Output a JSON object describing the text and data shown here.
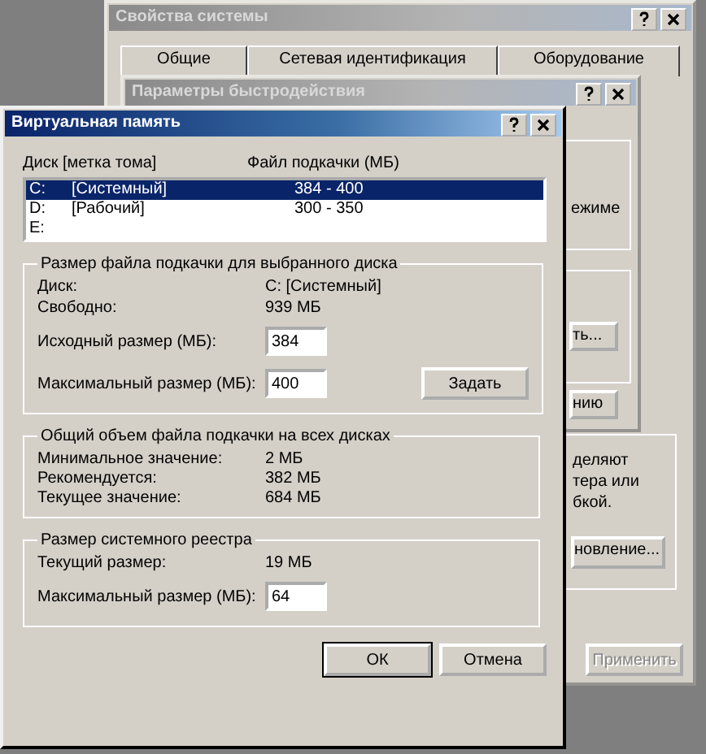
{
  "system_window": {
    "title": "Свойства системы",
    "tabs": [
      {
        "label": "Общие",
        "selected": false
      },
      {
        "label": "Сетевая идентификация",
        "selected": false
      },
      {
        "label": "Оборудование",
        "selected": false
      }
    ],
    "fragments": [
      {
        "kind": "label",
        "text": "деляют"
      },
      {
        "kind": "label",
        "text": "тера или"
      },
      {
        "kind": "label",
        "text": "бкой."
      },
      {
        "kind": "button",
        "text": "новление..."
      }
    ],
    "buttons": [
      {
        "label": "Применить",
        "disabled": true
      }
    ]
  },
  "performance_window": {
    "title": "Параметры быстродействия",
    "fragments": [
      {
        "kind": "label",
        "text": "ежиме"
      },
      {
        "kind": "button",
        "text": "ть..."
      },
      {
        "kind": "button",
        "text": "нию"
      }
    ]
  },
  "virtual_memory_window": {
    "title": "Виртуальная память",
    "list_columns": [
      "Диск [метка тома]",
      "Файл подкачки (МБ)"
    ],
    "drives": [
      {
        "letter": "C:",
        "label": "[Системный]",
        "size": "384 - 400",
        "selected": true
      },
      {
        "letter": "D:",
        "label": "[Рабочий]",
        "size": "300 - 350",
        "selected": false
      },
      {
        "letter": "E:",
        "selected": false
      }
    ],
    "selected_drive": {
      "title": "Размер файла подкачки для выбранного диска",
      "drive_label": "Диск:",
      "drive_value": "C:  [Системный]",
      "free_label": "Свободно:",
      "free_value": "939 МБ",
      "initial_label": "Исходный размер (МБ):",
      "initial_value": "384",
      "max_label": "Максимальный размер (МБ):",
      "max_value": "400",
      "set_button": "Задать"
    },
    "totals": {
      "title": "Общий объем файла подкачки на всех дисках",
      "rows": [
        {
          "label": "Минимальное значение:",
          "value": "2 МБ"
        },
        {
          "label": "Рекомендуется:",
          "value": "382 МБ"
        },
        {
          "label": "Текущее значение:",
          "value": "684 МБ"
        }
      ]
    },
    "registry": {
      "title": "Размер системного реестра",
      "current_label": "Текущий размер:",
      "current_value": "19 МБ",
      "max_label": "Максимальный размер (МБ):",
      "max_value": "64"
    },
    "buttons": [
      "ОК",
      "Отмена"
    ]
  }
}
